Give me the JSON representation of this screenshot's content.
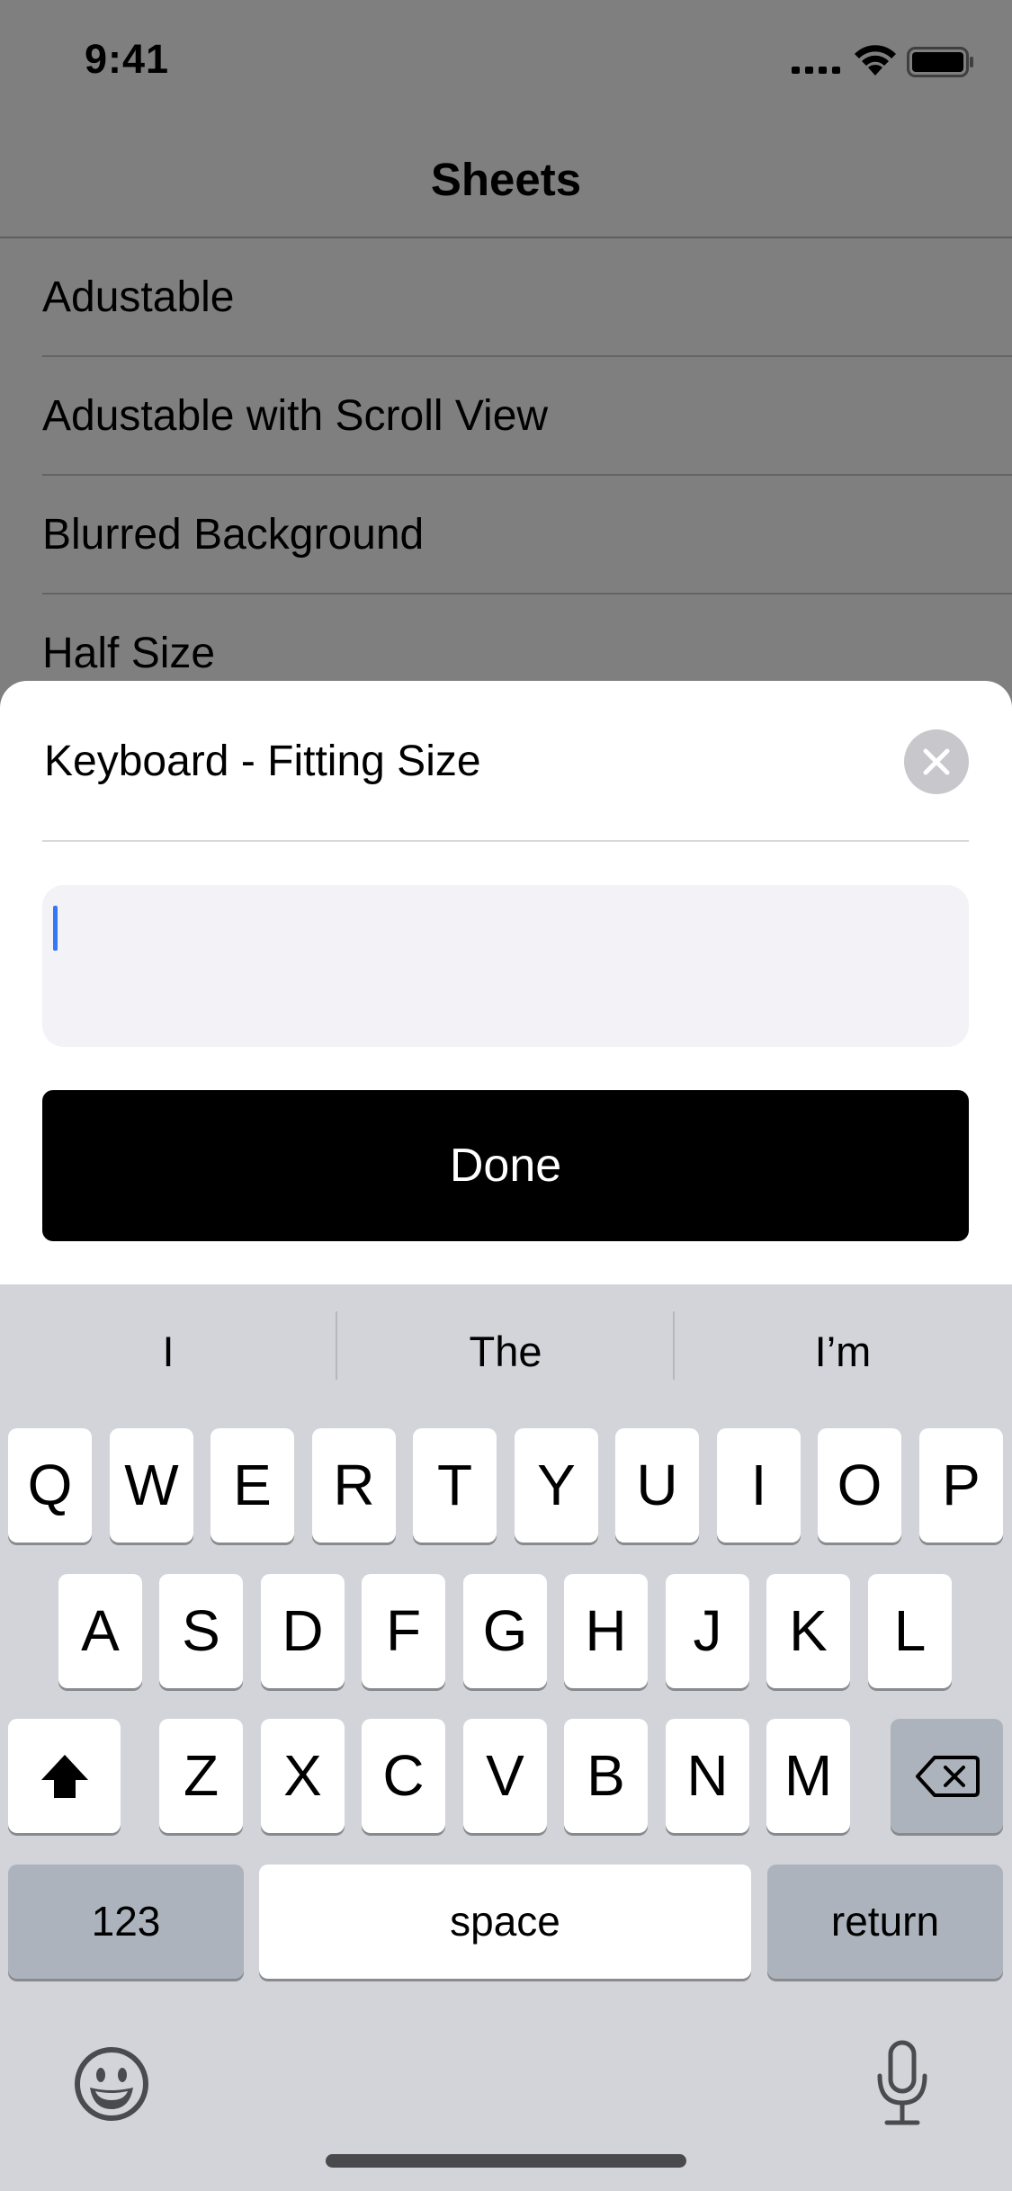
{
  "status_bar": {
    "time": "9:41",
    "signal_icon": "cellular-signal-icon",
    "wifi_icon": "wifi-icon",
    "battery_icon": "battery-icon"
  },
  "nav": {
    "title": "Sheets"
  },
  "list": {
    "items": [
      {
        "label": "Adustable"
      },
      {
        "label": "Adustable with Scroll View"
      },
      {
        "label": "Blurred Background"
      },
      {
        "label": "Half Size"
      }
    ]
  },
  "sheet": {
    "title": "Keyboard - Fitting Size",
    "close_icon": "close-icon",
    "input_value": "",
    "input_placeholder": "",
    "done_label": "Done"
  },
  "keyboard": {
    "suggestions": [
      "I",
      "The",
      "I’m"
    ],
    "row1": [
      "Q",
      "W",
      "E",
      "R",
      "T",
      "Y",
      "U",
      "I",
      "O",
      "P"
    ],
    "row2": [
      "A",
      "S",
      "D",
      "F",
      "G",
      "H",
      "J",
      "K",
      "L"
    ],
    "row3": [
      "Z",
      "X",
      "C",
      "V",
      "B",
      "N",
      "M"
    ],
    "shift_icon": "shift-icon",
    "delete_icon": "delete-icon",
    "numbers_label": "123",
    "space_label": "space",
    "return_label": "return",
    "emoji_icon": "emoji-icon",
    "mic_icon": "microphone-icon"
  },
  "colors": {
    "accent_cursor": "#3478f6",
    "done_button": "#000000",
    "keyboard_bg": "#d2d4d9",
    "dark_key": "#adb3bc"
  }
}
